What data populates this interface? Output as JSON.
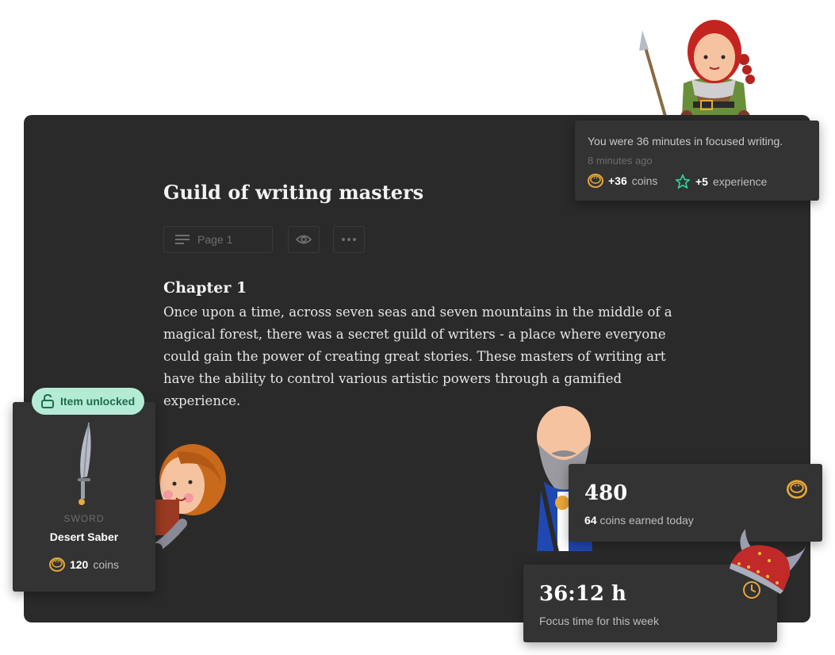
{
  "document": {
    "title": "Guild of writing masters",
    "page_label": "Page 1",
    "chapter_heading": "Chapter 1",
    "chapter_text": "Once upon a time, across seven seas and seven mountains in the middle of a magical forest, there was a secret guild of writers - a place where everyone could gain the power of creating great stories. These masters of writing art have the ability to control various artistic powers through a gamified experience."
  },
  "notification": {
    "message": "You were 36 minutes in focused writing.",
    "time": "8 minutes ago",
    "coins_value": "+36",
    "coins_label": "coins",
    "xp_value": "+5",
    "xp_label": "experience"
  },
  "item": {
    "badge": "Item unlocked",
    "category": "SWORD",
    "name": "Desert Saber",
    "price": "120",
    "price_label": "coins"
  },
  "coins_stat": {
    "total": "480",
    "today": "64",
    "today_label": "coins earned today"
  },
  "focus_stat": {
    "time": "36:12 h",
    "label": "Focus time for this week"
  },
  "colors": {
    "panel": "#2a2a2a",
    "card": "#333333",
    "coin": "#e8a83a",
    "star": "#2fd3a0",
    "badge_bg": "#b4ebd5",
    "badge_text": "#1f6b4e"
  },
  "icons": [
    "lines-icon",
    "eye-icon",
    "more-icon",
    "coin-icon",
    "star-icon",
    "unlock-icon",
    "clock-icon",
    "sword-icon"
  ]
}
